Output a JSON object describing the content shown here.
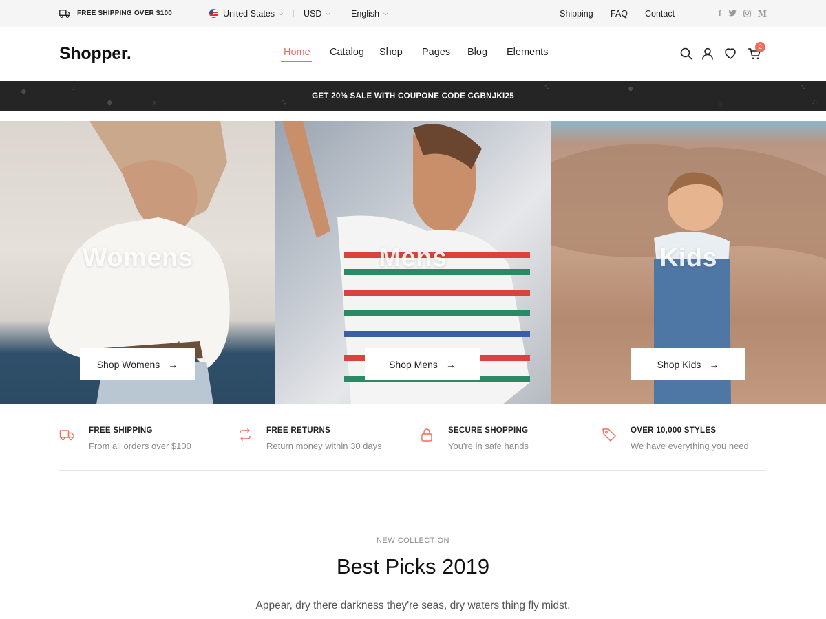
{
  "topbar": {
    "shipping_notice": "FREE SHIPPING OVER $100",
    "country": "United States",
    "currency": "USD",
    "language": "English",
    "links": [
      "Shipping",
      "FAQ",
      "Contact"
    ],
    "social": [
      "f",
      "t",
      "ig",
      "M"
    ]
  },
  "header": {
    "logo": "Shopper.",
    "nav": [
      "Home",
      "Catalog",
      "Shop",
      "Pages",
      "Blog",
      "Elements"
    ],
    "active_nav": "Home",
    "cart_count": "2",
    "icons": [
      "search-icon",
      "user-icon",
      "heart-icon",
      "cart-icon"
    ]
  },
  "promo": {
    "text": "GET 20% SALE WITH COUPONE CODE CGBNJKI25"
  },
  "hero": [
    {
      "title": "Womens",
      "button": "Shop Womens"
    },
    {
      "title": "Mens",
      "button": "Shop Mens"
    },
    {
      "title": "Kids",
      "button": "Shop Kids"
    }
  ],
  "features": [
    {
      "icon": "truck-icon",
      "title": "FREE SHIPPING",
      "subtitle": "From all orders over $100"
    },
    {
      "icon": "repeat-icon",
      "title": "FREE RETURNS",
      "subtitle": "Return money within 30 days"
    },
    {
      "icon": "lock-icon",
      "title": "SECURE SHOPPING",
      "subtitle": "You're in safe hands"
    },
    {
      "icon": "tag-icon",
      "title": "OVER 10,000 STYLES",
      "subtitle": "We have everything you need"
    }
  ],
  "collection": {
    "eyebrow": "NEW COLLECTION",
    "title": "Best Picks 2019",
    "description": "Appear, dry there darkness they're seas, dry waters thing fly midst."
  },
  "colors": {
    "accent": "#f26b5b",
    "promo_bg": "#252525",
    "topbar_bg": "#f5f5f5"
  }
}
